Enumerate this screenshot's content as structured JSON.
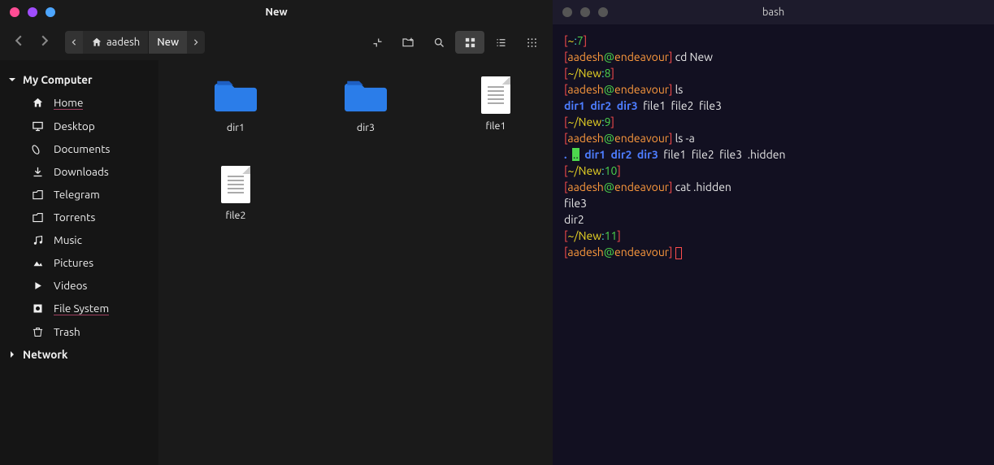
{
  "fm": {
    "title": "New",
    "dots": [
      "#ff4d94",
      "#a04dff",
      "#4da6ff"
    ],
    "breadcrumb": {
      "parent": "aadesh",
      "current": "New"
    },
    "sidebar": {
      "sections": [
        {
          "name": "My Computer",
          "expanded": true,
          "items": [
            {
              "icon": "home-icon",
              "label": "Home",
              "active": true
            },
            {
              "icon": "desktop-icon",
              "label": "Desktop"
            },
            {
              "icon": "documents-icon",
              "label": "Documents"
            },
            {
              "icon": "downloads-icon",
              "label": "Downloads"
            },
            {
              "icon": "telegram-icon",
              "label": "Telegram"
            },
            {
              "icon": "torrents-icon",
              "label": "Torrents"
            },
            {
              "icon": "music-icon",
              "label": "Music"
            },
            {
              "icon": "pictures-icon",
              "label": "Pictures"
            },
            {
              "icon": "videos-icon",
              "label": "Videos"
            },
            {
              "icon": "filesystem-icon",
              "label": "File System",
              "underline": true
            },
            {
              "icon": "trash-icon",
              "label": "Trash"
            }
          ]
        },
        {
          "name": "Network",
          "expanded": false,
          "items": []
        }
      ]
    },
    "items": [
      {
        "type": "folder",
        "name": "dir1"
      },
      {
        "type": "folder",
        "name": "dir3"
      },
      {
        "type": "file",
        "name": "file1"
      },
      {
        "type": "file",
        "name": "file2"
      }
    ]
  },
  "term": {
    "title": "bash",
    "lines": [
      [
        {
          "t": "[",
          "c": "red"
        },
        {
          "t": "~",
          "c": "yellow"
        },
        {
          "t": ":",
          "c": "cyan"
        },
        {
          "t": "7",
          "c": "green"
        },
        {
          "t": "]",
          "c": "red"
        }
      ],
      [
        {
          "t": "[",
          "c": "red"
        },
        {
          "t": "aadesh",
          "c": "orange"
        },
        {
          "t": "@",
          "c": "green"
        },
        {
          "t": "endeavour",
          "c": "orange"
        },
        {
          "t": "]",
          "c": "red"
        },
        {
          "t": " cd New",
          "c": "white"
        }
      ],
      [
        {
          "t": "[",
          "c": "red"
        },
        {
          "t": "~/New",
          "c": "yellow"
        },
        {
          "t": ":",
          "c": "cyan"
        },
        {
          "t": "8",
          "c": "green"
        },
        {
          "t": "]",
          "c": "red"
        }
      ],
      [
        {
          "t": "[",
          "c": "red"
        },
        {
          "t": "aadesh",
          "c": "orange"
        },
        {
          "t": "@",
          "c": "green"
        },
        {
          "t": "endeavour",
          "c": "orange"
        },
        {
          "t": "]",
          "c": "red"
        },
        {
          "t": " ls",
          "c": "white"
        }
      ],
      [
        {
          "t": "dir1",
          "c": "blue"
        },
        {
          "t": "  "
        },
        {
          "t": "dir2",
          "c": "blue"
        },
        {
          "t": "  "
        },
        {
          "t": "dir3",
          "c": "blue"
        },
        {
          "t": "  file1  file2  file3",
          "c": "white"
        }
      ],
      [
        {
          "t": "[",
          "c": "red"
        },
        {
          "t": "~/New",
          "c": "yellow"
        },
        {
          "t": ":",
          "c": "cyan"
        },
        {
          "t": "9",
          "c": "green"
        },
        {
          "t": "]",
          "c": "red"
        }
      ],
      [
        {
          "t": "[",
          "c": "red"
        },
        {
          "t": "aadesh",
          "c": "orange"
        },
        {
          "t": "@",
          "c": "green"
        },
        {
          "t": "endeavour",
          "c": "orange"
        },
        {
          "t": "]",
          "c": "red"
        },
        {
          "t": " ls -a",
          "c": "white"
        }
      ],
      [
        {
          "t": ".",
          "c": "blue"
        },
        {
          "t": "  "
        },
        {
          "t": "..",
          "c": "bggreen"
        },
        {
          "t": "  "
        },
        {
          "t": "dir1",
          "c": "blue"
        },
        {
          "t": "  "
        },
        {
          "t": "dir2",
          "c": "blue"
        },
        {
          "t": "  "
        },
        {
          "t": "dir3",
          "c": "blue"
        },
        {
          "t": "  file1  file2  file3  .hidden",
          "c": "white"
        }
      ],
      [
        {
          "t": "[",
          "c": "red"
        },
        {
          "t": "~/New",
          "c": "yellow"
        },
        {
          "t": ":",
          "c": "cyan"
        },
        {
          "t": "10",
          "c": "green"
        },
        {
          "t": "]",
          "c": "red"
        }
      ],
      [
        {
          "t": "[",
          "c": "red"
        },
        {
          "t": "aadesh",
          "c": "orange"
        },
        {
          "t": "@",
          "c": "green"
        },
        {
          "t": "endeavour",
          "c": "orange"
        },
        {
          "t": "]",
          "c": "red"
        },
        {
          "t": " cat .hidden",
          "c": "white"
        }
      ],
      [
        {
          "t": "file3",
          "c": "white"
        }
      ],
      [
        {
          "t": "dir2",
          "c": "white"
        }
      ],
      [
        {
          "t": "[",
          "c": "red"
        },
        {
          "t": "~/New",
          "c": "yellow"
        },
        {
          "t": ":",
          "c": "cyan"
        },
        {
          "t": "11",
          "c": "green"
        },
        {
          "t": "]",
          "c": "red"
        }
      ],
      [
        {
          "t": "[",
          "c": "red"
        },
        {
          "t": "aadesh",
          "c": "orange"
        },
        {
          "t": "@",
          "c": "green"
        },
        {
          "t": "endeavour",
          "c": "orange"
        },
        {
          "t": "]",
          "c": "red"
        },
        {
          "t": " ",
          "c": "white"
        },
        {
          "t": "",
          "c": "cursor"
        }
      ]
    ]
  }
}
